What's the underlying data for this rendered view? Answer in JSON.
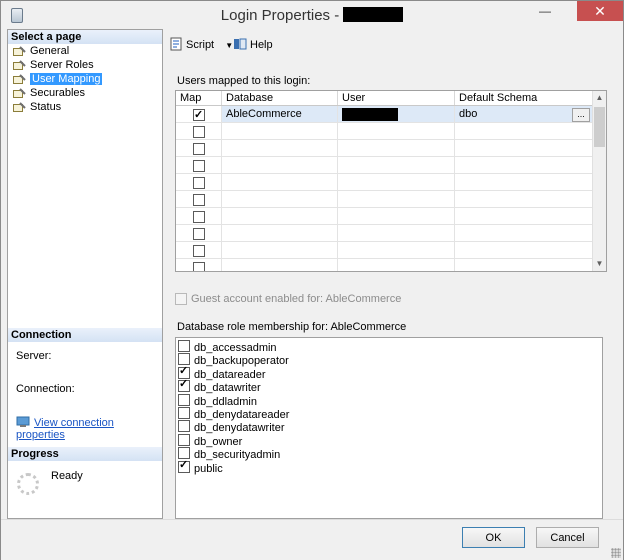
{
  "window": {
    "title": "Login Properties -",
    "controls": {
      "minimize": "—",
      "maximize": "☐",
      "close": "✕"
    }
  },
  "sidebar": {
    "select_page_heading": "Select a page",
    "pages": [
      {
        "label": "General",
        "selected": false
      },
      {
        "label": "Server Roles",
        "selected": false
      },
      {
        "label": "User Mapping",
        "selected": true
      },
      {
        "label": "Securables",
        "selected": false
      },
      {
        "label": "Status",
        "selected": false
      }
    ],
    "connection_heading": "Connection",
    "server_label": "Server:",
    "connection_label": "Connection:",
    "view_connection_properties": "View connection properties",
    "progress_heading": "Progress",
    "progress_status": "Ready"
  },
  "toolbar": {
    "script_label": "Script",
    "help_label": "Help"
  },
  "users_mapped": {
    "label": "Users mapped to this login:",
    "columns": [
      "Map",
      "Database",
      "User",
      "Default Schema"
    ],
    "rows": [
      {
        "map": true,
        "database": "AbleCommerce",
        "user_redacted": true,
        "schema": "dbo",
        "has_browse": true,
        "browse_label": "..."
      },
      {
        "map": false,
        "database": "",
        "user_redacted": false,
        "schema": "",
        "has_browse": false,
        "browse_label": ""
      },
      {
        "map": false,
        "database": "",
        "user_redacted": false,
        "schema": "",
        "has_browse": false,
        "browse_label": ""
      },
      {
        "map": false,
        "database": "",
        "user_redacted": false,
        "schema": "",
        "has_browse": false,
        "browse_label": ""
      },
      {
        "map": false,
        "database": "",
        "user_redacted": false,
        "schema": "",
        "has_browse": false,
        "browse_label": ""
      },
      {
        "map": false,
        "database": "",
        "user_redacted": false,
        "schema": "",
        "has_browse": false,
        "browse_label": ""
      },
      {
        "map": false,
        "database": "",
        "user_redacted": false,
        "schema": "",
        "has_browse": false,
        "browse_label": ""
      },
      {
        "map": false,
        "database": "",
        "user_redacted": false,
        "schema": "",
        "has_browse": false,
        "browse_label": ""
      },
      {
        "map": false,
        "database": "",
        "user_redacted": false,
        "schema": "",
        "has_browse": false,
        "browse_label": ""
      },
      {
        "map": false,
        "database": "",
        "user_redacted": false,
        "schema": "",
        "has_browse": false,
        "browse_label": ""
      }
    ]
  },
  "guest": {
    "label": "Guest account enabled for: AbleCommerce",
    "checked": false,
    "disabled": true
  },
  "roles": {
    "label": "Database role membership for: AbleCommerce",
    "items": [
      {
        "name": "db_accessadmin",
        "checked": false
      },
      {
        "name": "db_backupoperator",
        "checked": false
      },
      {
        "name": "db_datareader",
        "checked": true
      },
      {
        "name": "db_datawriter",
        "checked": true
      },
      {
        "name": "db_ddladmin",
        "checked": false
      },
      {
        "name": "db_denydatareader",
        "checked": false
      },
      {
        "name": "db_denydatawriter",
        "checked": false
      },
      {
        "name": "db_owner",
        "checked": false
      },
      {
        "name": "db_securityadmin",
        "checked": false
      },
      {
        "name": "public",
        "checked": true
      }
    ]
  },
  "buttons": {
    "ok": "OK",
    "cancel": "Cancel"
  },
  "colors": {
    "selection": "#3399ff",
    "link": "#1a55c4",
    "close_button": "#c75050"
  }
}
